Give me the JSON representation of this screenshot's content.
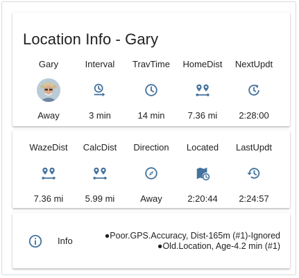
{
  "title": "Location Info - Gary",
  "row1": [
    {
      "label": "Gary",
      "value": "Away",
      "icon": "avatar"
    },
    {
      "label": "Interval",
      "value": "3 min",
      "icon": "timer-arrow-icon"
    },
    {
      "label": "TravTime",
      "value": "14 min",
      "icon": "clock-icon"
    },
    {
      "label": "HomeDist",
      "value": "7.36 mi",
      "icon": "map-marker-distance-icon"
    },
    {
      "label": "NextUpdt",
      "value": "2:28:00",
      "icon": "clock-refresh-icon"
    }
  ],
  "row2": [
    {
      "label": "WazeDist",
      "value": "7.36 mi",
      "icon": "map-marker-distance-icon"
    },
    {
      "label": "CalcDist",
      "value": "5.99 mi",
      "icon": "map-marker-distance-icon"
    },
    {
      "label": "Direction",
      "value": "Away",
      "icon": "compass-icon"
    },
    {
      "label": "Located",
      "value": "2:20:44",
      "icon": "map-clock-icon"
    },
    {
      "label": "LastUpdt",
      "value": "2:24:57",
      "icon": "history-icon"
    }
  ],
  "info": {
    "label": "Info",
    "line1": "●Poor.GPS.Accuracy, Dist-165m (#1)-Ignored",
    "line2": "●Old.Location, Age-4.2 min (#1)"
  },
  "colors": {
    "icon": "#44739e",
    "text": "#212121"
  }
}
